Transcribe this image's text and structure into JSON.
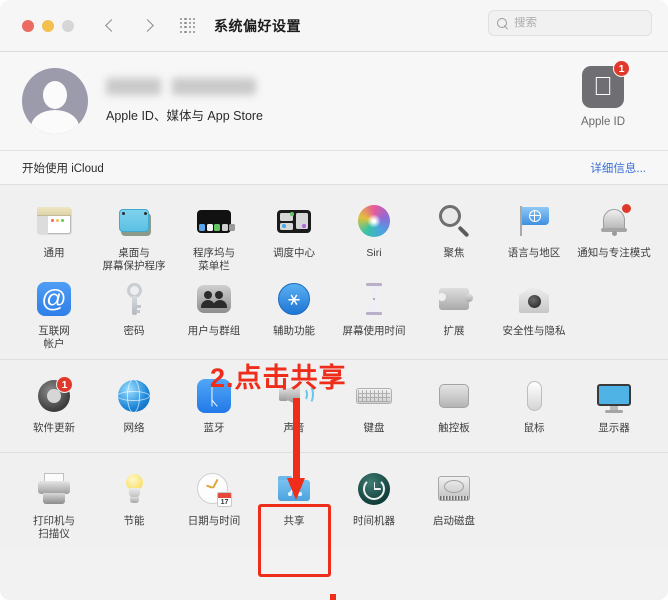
{
  "window": {
    "title": "系统偏好设置",
    "traffic_lights": [
      "close",
      "minimize",
      "zoom-disabled"
    ],
    "nav": {
      "back": "back-chevron",
      "forward": "forward-chevron",
      "grid": "show-all-grid"
    }
  },
  "search": {
    "placeholder": "搜索",
    "value": "",
    "icon": "search-icon"
  },
  "account": {
    "name": "",
    "subtitle": "Apple ID、媒体与 App Store",
    "avatar_icon": "person-avatar-icon",
    "appleid": {
      "label": "Apple ID",
      "icon": "apple-logo-icon",
      "badge": "1"
    }
  },
  "icloud": {
    "label": "开始使用 iCloud",
    "link": "详细信息..."
  },
  "annotation": {
    "text": "2.点击共享",
    "color": "#ee2d1b",
    "arrow": "down-arrow",
    "highlight_target": "共享"
  },
  "panes": [
    {
      "group": 1,
      "items": [
        {
          "label": "通用",
          "icon": "general-icon",
          "badge": null
        },
        {
          "label": "桌面与\n屏幕保护程序",
          "icon": "desktop-screensaver-icon",
          "badge": null
        },
        {
          "label": "程序坞与\n菜单栏",
          "icon": "dock-menubar-icon",
          "badge": null
        },
        {
          "label": "调度中心",
          "icon": "mission-control-icon",
          "badge": null
        },
        {
          "label": "Siri",
          "icon": "siri-icon",
          "badge": null
        },
        {
          "label": "聚焦",
          "icon": "spotlight-icon",
          "badge": null
        },
        {
          "label": "语言与地区",
          "icon": "language-region-icon",
          "badge": null
        },
        {
          "label": "通知与专注模式",
          "icon": "notifications-focus-icon",
          "badge": "dot"
        },
        {
          "label": "互联网\n帐户",
          "icon": "internet-accounts-icon",
          "badge": null
        },
        {
          "label": "密码",
          "icon": "passwords-key-icon",
          "badge": null
        },
        {
          "label": "用户与群组",
          "icon": "users-groups-icon",
          "badge": null
        },
        {
          "label": "辅助功能",
          "icon": "accessibility-icon",
          "badge": null
        },
        {
          "label": "屏幕使用时间",
          "icon": "screen-time-icon",
          "badge": null
        },
        {
          "label": "扩展",
          "icon": "extensions-puzzle-icon",
          "badge": null
        },
        {
          "label": "安全性与隐私",
          "icon": "security-privacy-icon",
          "badge": null
        }
      ]
    },
    {
      "group": 2,
      "items": [
        {
          "label": "软件更新",
          "icon": "software-update-icon",
          "badge": "1"
        },
        {
          "label": "网络",
          "icon": "network-globe-icon",
          "badge": null
        },
        {
          "label": "蓝牙",
          "icon": "bluetooth-icon",
          "badge": null
        },
        {
          "label": "声音",
          "icon": "sound-speaker-icon",
          "badge": null
        },
        {
          "label": "键盘",
          "icon": "keyboard-icon",
          "badge": null
        },
        {
          "label": "触控板",
          "icon": "trackpad-icon",
          "badge": null
        },
        {
          "label": "鼠标",
          "icon": "mouse-icon",
          "badge": null
        },
        {
          "label": "显示器",
          "icon": "displays-icon",
          "badge": null
        }
      ]
    },
    {
      "group": 3,
      "items": [
        {
          "label": "打印机与\n扫描仪",
          "icon": "printers-scanners-icon",
          "badge": null
        },
        {
          "label": "节能",
          "icon": "energy-saver-icon",
          "badge": null
        },
        {
          "label": "日期与时间",
          "icon": "date-time-icon",
          "badge": null
        },
        {
          "label": "共享",
          "icon": "sharing-folder-icon",
          "badge": null,
          "highlighted": true
        },
        {
          "label": "时间机器",
          "icon": "time-machine-icon",
          "badge": null
        },
        {
          "label": "启动磁盘",
          "icon": "startup-disk-icon",
          "badge": null
        }
      ]
    }
  ]
}
